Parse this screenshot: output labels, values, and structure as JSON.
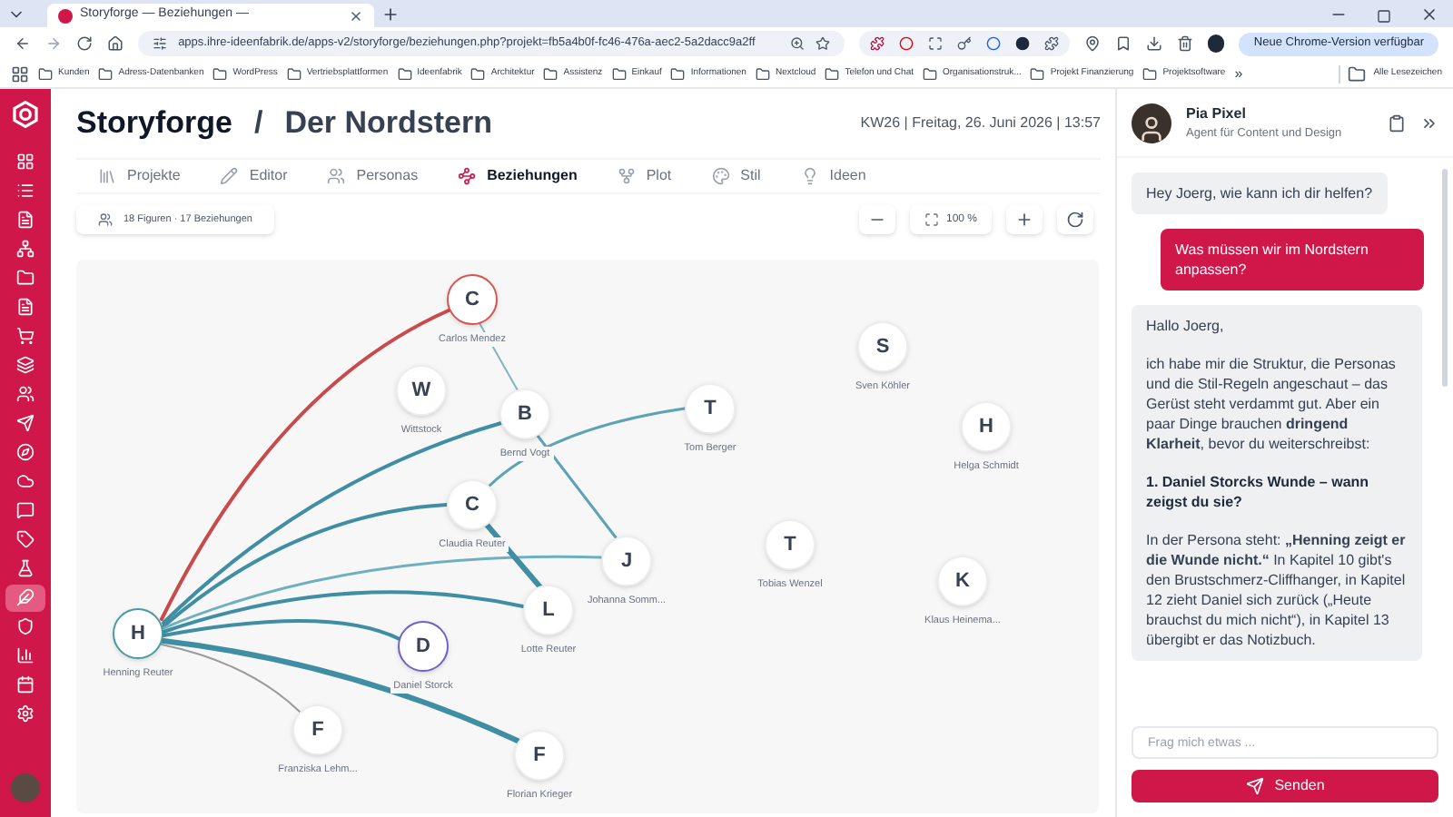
{
  "browser": {
    "tab_title": "Storyforge — Beziehungen —",
    "url": "apps.ihre-ideenfabrik.de/apps-v2/storyforge/beziehungen.php?projekt=fb5a4b0f-fc46-476a-aec2-5a2dacc9a2ff",
    "update_button": "Neue Chrome-Version verfügbar",
    "bookmarks": [
      {
        "label": "Kunden"
      },
      {
        "label": "Adress-Datenbanken"
      },
      {
        "label": "WordPress"
      },
      {
        "label": "Vertriebsplattformen"
      },
      {
        "label": "Ideenfabrik"
      },
      {
        "label": "Architektur"
      },
      {
        "label": "Assistenz"
      },
      {
        "label": "Einkauf"
      },
      {
        "label": "Informationen"
      },
      {
        "label": "Nextcloud"
      },
      {
        "label": "Telefon und Chat"
      },
      {
        "label": "Organisationstruk..."
      },
      {
        "label": "Projekt Finanzierung"
      },
      {
        "label": "Projektsoftware"
      }
    ],
    "more": "»",
    "all_bookmarks": "Alle Lesezeichen"
  },
  "sidebar": {
    "items": [
      {
        "selected": false
      },
      {
        "selected": false
      },
      {
        "selected": false
      },
      {
        "selected": false
      },
      {
        "selected": false
      },
      {
        "selected": false
      },
      {
        "selected": false
      },
      {
        "selected": false
      },
      {
        "selected": false
      },
      {
        "selected": false
      },
      {
        "selected": false
      },
      {
        "selected": false
      },
      {
        "selected": false
      },
      {
        "selected": false
      },
      {
        "selected": false
      },
      {
        "selected": true
      },
      {
        "selected": false
      },
      {
        "selected": false
      },
      {
        "selected": false
      },
      {
        "selected": false
      }
    ]
  },
  "header": {
    "app": "Storyforge",
    "separator": "/",
    "project": "Der Nordstern",
    "datetime": "KW26 | Freitag, 26. Juni 2026 | 13:57"
  },
  "tabs": [
    {
      "label": "Projekte",
      "selected": false
    },
    {
      "label": "Editor",
      "selected": false
    },
    {
      "label": "Personas",
      "selected": false
    },
    {
      "label": "Beziehungen",
      "selected": true
    },
    {
      "label": "Plot",
      "selected": false
    },
    {
      "label": "Stil",
      "selected": false
    },
    {
      "label": "Ideen",
      "selected": false
    }
  ],
  "toolbar": {
    "summary": "18 Figuren · 17 Beziehungen",
    "zoom": "100 %"
  },
  "graph": {
    "nodes": [
      {
        "initial": "C",
        "name": "Carlos Mendez",
        "color": "#d9534f"
      },
      {
        "initial": "W",
        "name": "Wittstock",
        "color": "#ededed"
      },
      {
        "initial": "B",
        "name": "Bernd Vogt",
        "color": "#ededed"
      },
      {
        "initial": "T",
        "name": "Tom Berger",
        "color": "#ededed"
      },
      {
        "initial": "S",
        "name": "Sven Köhler",
        "color": "#ededed"
      },
      {
        "initial": "H",
        "name": "Helga Schmidt",
        "color": "#ededed"
      },
      {
        "initial": "C",
        "name": "Claudia Reuter",
        "color": "#ededed"
      },
      {
        "initial": "J",
        "name": "Johanna Somm...",
        "color": "#ededed"
      },
      {
        "initial": "L",
        "name": "Lotte Reuter",
        "color": "#ededed"
      },
      {
        "initial": "T",
        "name": "Tobias Wenzel",
        "color": "#ededed"
      },
      {
        "initial": "K",
        "name": "Klaus Heinema...",
        "color": "#ededed"
      },
      {
        "initial": "H",
        "name": "Henning Reuter",
        "color": "#4a9aa6"
      },
      {
        "initial": "D",
        "name": "Daniel Storck",
        "color": "#6f63c9"
      },
      {
        "initial": "F",
        "name": "Franziska Lehm...",
        "color": "#ededed"
      },
      {
        "initial": "F",
        "name": "Florian Krieger",
        "color": "#ededed"
      }
    ],
    "edges": [
      {
        "kind": "normal",
        "color": "#c94a4a"
      },
      {
        "kind": "normal",
        "color": "#3f8ea3"
      },
      {
        "kind": "normal",
        "color": "#3f8ea3"
      },
      {
        "kind": "thin",
        "color": "#6fb0c0"
      },
      {
        "kind": "normal",
        "color": "#3f8ea3"
      },
      {
        "kind": "normal",
        "color": "#3f8ea3"
      },
      {
        "kind": "strong",
        "color": "#3f8ea3"
      },
      {
        "kind": "hair",
        "color": "#9a9a9a"
      },
      {
        "kind": "hair",
        "color": "#7fb6c4"
      },
      {
        "kind": "thin",
        "color": "#5ea3b5"
      },
      {
        "kind": "thin",
        "color": "#5ea3b5"
      },
      {
        "kind": "strong",
        "color": "#3f8ea3"
      }
    ]
  },
  "chat": {
    "agent_name": "Pia Pixel",
    "agent_role": "Agent für Content und Design",
    "messages": [
      {
        "kind": "assistant",
        "paragraphs": [
          {
            "kind": "text",
            "text": "Hey Joerg, wie kann ich dir helfen?"
          }
        ]
      },
      {
        "kind": "user",
        "paragraphs": [
          {
            "kind": "text",
            "text": "Was müssen wir im Nordstern anpassen?"
          }
        ]
      },
      {
        "kind": "assistant",
        "paragraphs": [
          {
            "kind": "text",
            "text": "Hallo Joerg,"
          },
          {
            "kind": "text",
            "text": "ich habe mir die Struktur, die Personas und die Stil-Regeln angeschaut – das Gerüst steht verdammt gut. Aber ein paar Dinge brauchen **dringend Klarheit**, bevor du weiterschreibst:"
          },
          {
            "kind": "heading",
            "text": "1. Daniel Storcks Wunde – wann zeigst du sie?"
          },
          {
            "kind": "text",
            "text": "In der Persona steht: **„Henning zeigt er die Wunde nicht.“** In Kapitel 10 gibt's den Brustschmerz-Cliffhanger, in Kapitel 12 zieht Daniel sich zurück („Heute brauchst du mich nicht“), in Kapitel 13 übergibt er das Notizbuch."
          }
        ]
      }
    ],
    "input": {
      "placeholder": "Frag mich etwas ..."
    },
    "send_button": "Senden"
  }
}
